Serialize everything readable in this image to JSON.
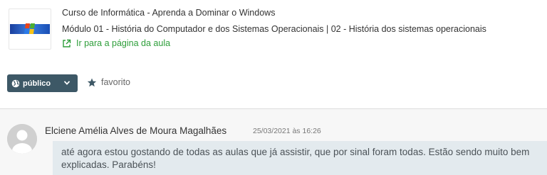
{
  "course": {
    "title": "Curso de Informática - Aprenda a Dominar o Windows",
    "module_line": "Módulo 01 - História do Computador e dos Sistemas Operacionais | 02 - História dos sistemas operacionais",
    "lesson_link_label": "Ir para a página da aula",
    "thumbnail_icon": "windows-xp-logo",
    "link_icon": "external-link-icon",
    "link_color": "#2e9e3a"
  },
  "actions": {
    "visibility_label": "público",
    "visibility_icon": "globe-icon",
    "visibility_bg": "#3d5866",
    "favorite_label": "favorito",
    "favorite_icon": "star-icon"
  },
  "comment": {
    "author": "Elciene Amélia Alves de Moura Magalhães",
    "timestamp": "25/03/2021 às 16:26",
    "text": "até agora estou gostando de todas as aulas que já assistir, que por sinal foram todas. Estão sendo muito bem explicadas. Parabéns!",
    "avatar_icon": "user-avatar-icon",
    "bubble_bg": "#e3eaee"
  }
}
